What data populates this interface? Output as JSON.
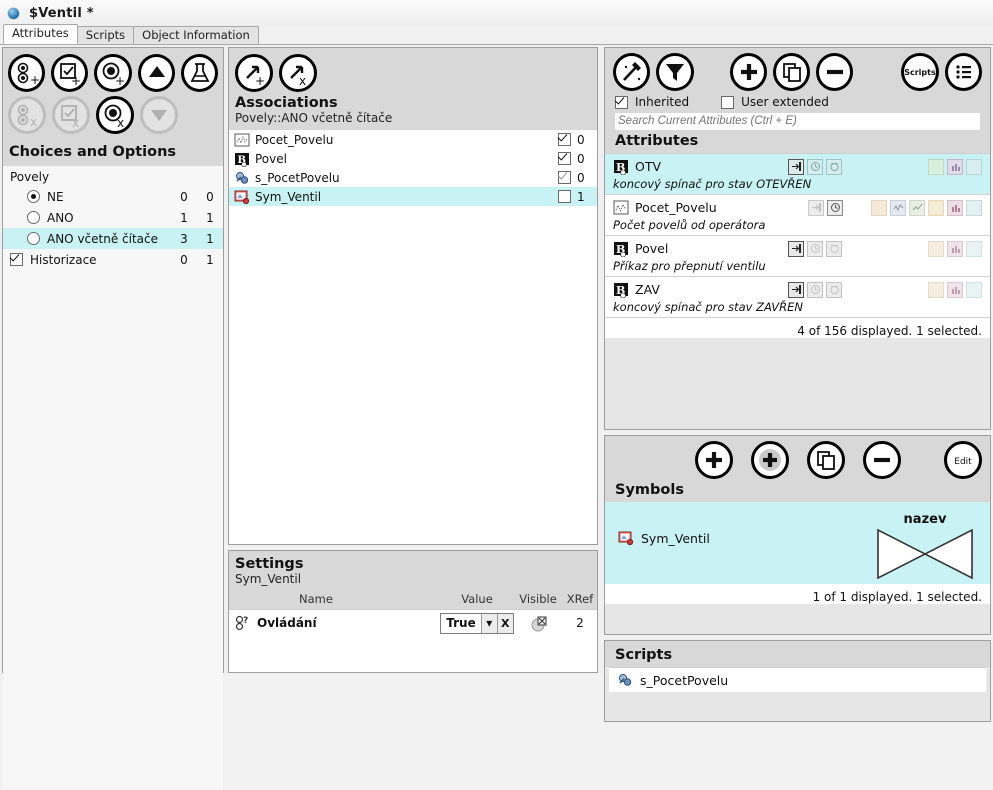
{
  "window": {
    "title": "$Ventil *",
    "bullet_icon": "object-bullet-icon"
  },
  "tabs": [
    {
      "label": "Attributes",
      "active": true
    },
    {
      "label": "Scripts",
      "active": false
    },
    {
      "label": "Object Information",
      "active": false
    }
  ],
  "left_panel": {
    "toolbar_row1": [
      {
        "name": "add-choice-button",
        "icon": "add-choice-icon",
        "enabled": true
      },
      {
        "name": "add-option-button",
        "icon": "add-checkbox-option-icon",
        "enabled": true
      },
      {
        "name": "add-value-button",
        "icon": "add-radio-value-icon",
        "enabled": true
      },
      {
        "name": "move-up-button",
        "icon": "arrow-up-icon",
        "enabled": true
      },
      {
        "name": "test-button",
        "icon": "flask-icon",
        "enabled": true
      }
    ],
    "toolbar_row2": [
      {
        "name": "delete-choice-button",
        "icon": "delete-choice-icon",
        "enabled": false
      },
      {
        "name": "delete-option-button",
        "icon": "delete-checkbox-option-icon",
        "enabled": false
      },
      {
        "name": "delete-value-button",
        "icon": "delete-radio-value-icon",
        "enabled": true
      },
      {
        "name": "move-down-button",
        "icon": "arrow-down-icon",
        "enabled": false
      }
    ],
    "heading": "Choices and Options",
    "group_label": "Povely",
    "options": [
      {
        "label": "NE",
        "type": "radio",
        "checked": true,
        "selected": false,
        "n1": "0",
        "n2": "0"
      },
      {
        "label": "ANO",
        "type": "radio",
        "checked": false,
        "selected": false,
        "n1": "1",
        "n2": "1"
      },
      {
        "label": "ANO včetně čítače",
        "type": "radio",
        "checked": false,
        "selected": true,
        "n1": "3",
        "n2": "1"
      },
      {
        "label": "Historizace",
        "type": "checkbox",
        "checked": true,
        "selected": false,
        "n1": "0",
        "n2": "1"
      }
    ]
  },
  "associations": {
    "toolbar": [
      {
        "name": "add-association-button",
        "icon": "add-link-icon",
        "enabled": true
      },
      {
        "name": "remove-association-button",
        "icon": "remove-link-icon",
        "enabled": true
      }
    ],
    "heading": "Associations",
    "subheading": "Povely::ANO včetně čítače",
    "items": [
      {
        "label": "Pocet_Povelu",
        "icon": "analog-attribute-icon",
        "checked": true,
        "checkbox_enabled": true,
        "count": "0",
        "selected": false
      },
      {
        "label": "Povel",
        "icon": "binary-attribute-icon",
        "checked": true,
        "checkbox_enabled": true,
        "count": "0",
        "selected": false
      },
      {
        "label": "s_PocetPovelu",
        "icon": "script-icon",
        "checked": true,
        "checkbox_enabled": false,
        "count": "0",
        "selected": false
      },
      {
        "label": "Sym_Ventil",
        "icon": "symbol-icon",
        "checked": false,
        "checkbox_enabled": true,
        "count": "1",
        "selected": true
      }
    ]
  },
  "settings": {
    "heading": "Settings",
    "subheading": "Sym_Ventil",
    "columns": {
      "name": "Name",
      "value": "Value",
      "visible": "Visible",
      "xref": "XRef"
    },
    "rows": [
      {
        "icon": "property-question-icon",
        "name": "Ovládání",
        "value": "True",
        "dropdown_arrow": "▾",
        "clear_label": "X",
        "visible_icon": "visible-toggle-icon",
        "xref": "2"
      }
    ]
  },
  "attributes": {
    "toolbar": [
      {
        "name": "wizard-button",
        "icon": "magic-wand-icon",
        "enabled": true
      },
      {
        "name": "filter-button",
        "icon": "funnel-icon",
        "enabled": true
      },
      {
        "name": "add-attribute-button",
        "icon": "plus-icon",
        "enabled": true
      },
      {
        "name": "duplicate-attribute-button",
        "icon": "copy-icon",
        "enabled": true
      },
      {
        "name": "remove-attribute-button",
        "icon": "minus-icon",
        "enabled": true
      },
      {
        "name": "scripts-button",
        "icon": "scripts-text-icon",
        "label": "Scripts",
        "enabled": true
      },
      {
        "name": "list-view-button",
        "icon": "list-icon",
        "enabled": true
      }
    ],
    "filters": [
      {
        "label": "Inherited",
        "checked": true
      },
      {
        "label": "User extended",
        "checked": false
      }
    ],
    "search_placeholder": "Search Current Attributes (Ctrl + E)",
    "search_value": "",
    "heading": "Attributes",
    "items": [
      {
        "name": "OTV",
        "icon": "binary-attribute-icon",
        "description": "koncový spínač pro stav OTEVŘEN",
        "selected": true,
        "badges_left": [
          "input-badge",
          "clock-badge",
          "alarm-badge"
        ],
        "badges_right": [
          "levels-badge",
          "chart-badge",
          "grid-badge"
        ]
      },
      {
        "name": "Pocet_Povelu",
        "icon": "analog-attribute-icon",
        "description": "Počet povelů od operátora",
        "selected": false,
        "badges_left": [
          "input-badge",
          "clock-badge"
        ],
        "badges_right": [
          "levels-badge",
          "trend-badge",
          "trend2-badge",
          "bars-badge",
          "chart-badge",
          "grid-badge"
        ]
      },
      {
        "name": "Povel",
        "icon": "binary-attribute-icon",
        "description": "Příkaz pro přepnutí ventilu",
        "selected": false,
        "badges_left": [
          "input-badge",
          "clock-badge",
          "alarm-badge"
        ],
        "badges_right": [
          "levels-badge",
          "chart-badge",
          "grid-badge"
        ]
      },
      {
        "name": "ZAV",
        "icon": "binary-attribute-icon",
        "description": "koncový spínač pro stav ZAVŘEN",
        "selected": false,
        "badges_left": [
          "input-badge",
          "clock-badge",
          "alarm-badge"
        ],
        "badges_right": [
          "levels-badge",
          "chart-badge",
          "grid-badge"
        ]
      }
    ],
    "status": "4 of 156 displayed. 1 selected."
  },
  "symbols": {
    "toolbar": [
      {
        "name": "add-symbol-button",
        "icon": "plus-icon",
        "enabled": true
      },
      {
        "name": "add-symbol-alt-button",
        "icon": "plus-icon",
        "enabled": false
      },
      {
        "name": "duplicate-symbol-button",
        "icon": "copy-icon",
        "enabled": true
      },
      {
        "name": "remove-symbol-button",
        "icon": "minus-icon",
        "enabled": true
      },
      {
        "name": "edit-symbol-button",
        "icon": "edit-text-icon",
        "label": "Edit",
        "enabled": true
      }
    ],
    "heading": "Symbols",
    "items": [
      {
        "label": "Sym_Ventil",
        "icon": "symbol-icon",
        "preview_label": "nazev",
        "preview_icon": "valve-shape-icon",
        "selected": true
      }
    ],
    "status": "1 of 1 displayed. 1 selected."
  },
  "scripts": {
    "heading": "Scripts",
    "items": [
      {
        "label": "s_PocetPovelu",
        "icon": "script-icon"
      }
    ]
  },
  "colors": {
    "selection": "#c8f2f3",
    "panel_header": "#d8d8d8",
    "panel_bg": "#f0f0f0",
    "white": "#ffffff"
  }
}
